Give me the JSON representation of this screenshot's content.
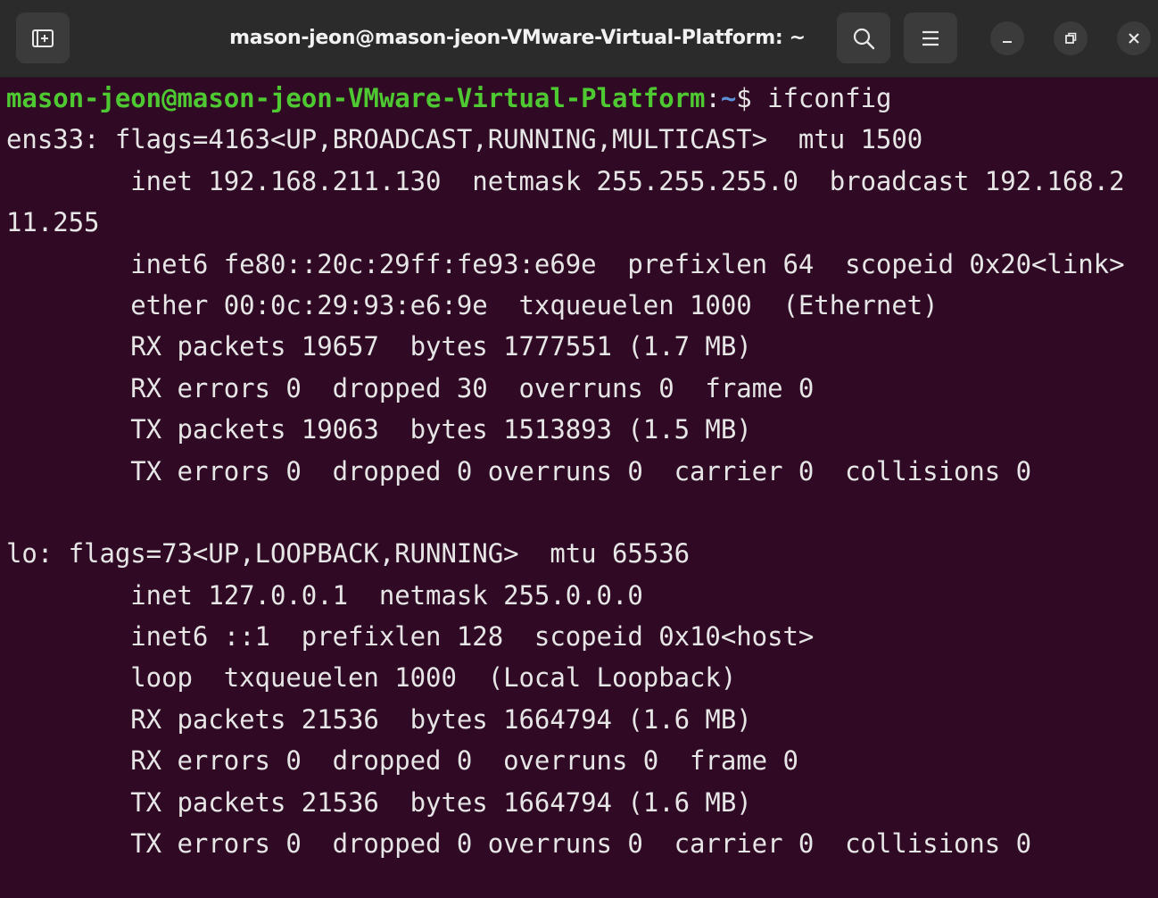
{
  "window": {
    "title": "mason-jeon@mason-jeon-VMware-Virtual-Platform: ~"
  },
  "icons": {
    "new_tab": "new-tab-icon",
    "search": "search-icon",
    "menu": "hamburger-menu-icon",
    "minimize": "minimize-icon",
    "maximize": "restore-icon",
    "close": "close-icon"
  },
  "colors": {
    "background": "#300a24",
    "prompt_user": "#4ec932",
    "prompt_path": "#5c8fd6",
    "text": "#e6e6e6"
  },
  "prompt": {
    "user_host": "mason-jeon@mason-jeon-VMware-Virtual-Platform",
    "separator": ":",
    "path": "~",
    "symbol": "$ ",
    "command": "ifconfig"
  },
  "output_lines": [
    "ens33: flags=4163<UP,BROADCAST,RUNNING,MULTICAST>  mtu 1500",
    "        inet 192.168.211.130  netmask 255.255.255.0  broadcast 192.168.2",
    "11.255",
    "        inet6 fe80::20c:29ff:fe93:e69e  prefixlen 64  scopeid 0x20<link>",
    "        ether 00:0c:29:93:e6:9e  txqueuelen 1000  (Ethernet)",
    "        RX packets 19657  bytes 1777551 (1.7 MB)",
    "        RX errors 0  dropped 30  overruns 0  frame 0",
    "        TX packets 19063  bytes 1513893 (1.5 MB)",
    "        TX errors 0  dropped 0 overruns 0  carrier 0  collisions 0",
    "",
    "lo: flags=73<UP,LOOPBACK,RUNNING>  mtu 65536",
    "        inet 127.0.0.1  netmask 255.0.0.0",
    "        inet6 ::1  prefixlen 128  scopeid 0x10<host>",
    "        loop  txqueuelen 1000  (Local Loopback)",
    "        RX packets 21536  bytes 1664794 (1.6 MB)",
    "        RX errors 0  dropped 0  overruns 0  frame 0",
    "        TX packets 21536  bytes 1664794 (1.6 MB)",
    "        TX errors 0  dropped 0 overruns 0  carrier 0  collisions 0"
  ]
}
